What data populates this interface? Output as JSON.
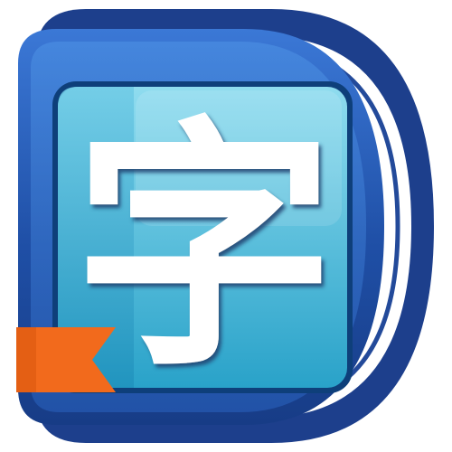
{
  "app_icon": {
    "glyph": "字",
    "icon_shapes": [
      "book-cover",
      "page-edges",
      "screen-panel",
      "bookmark-ribbon"
    ],
    "colors": {
      "cover_dark": "#1d3f8c",
      "cover_light": "#4a8fe0",
      "page_white": "#ffffff",
      "page_line": "#234a9a",
      "screen_top": "#7fd6ec",
      "screen_bottom": "#2aa6cc",
      "screen_border": "#0e3f7a",
      "glyph_fill": "#ffffff",
      "glyph_shadow": "#1a3f6e",
      "ribbon": "#f26a1c"
    }
  }
}
